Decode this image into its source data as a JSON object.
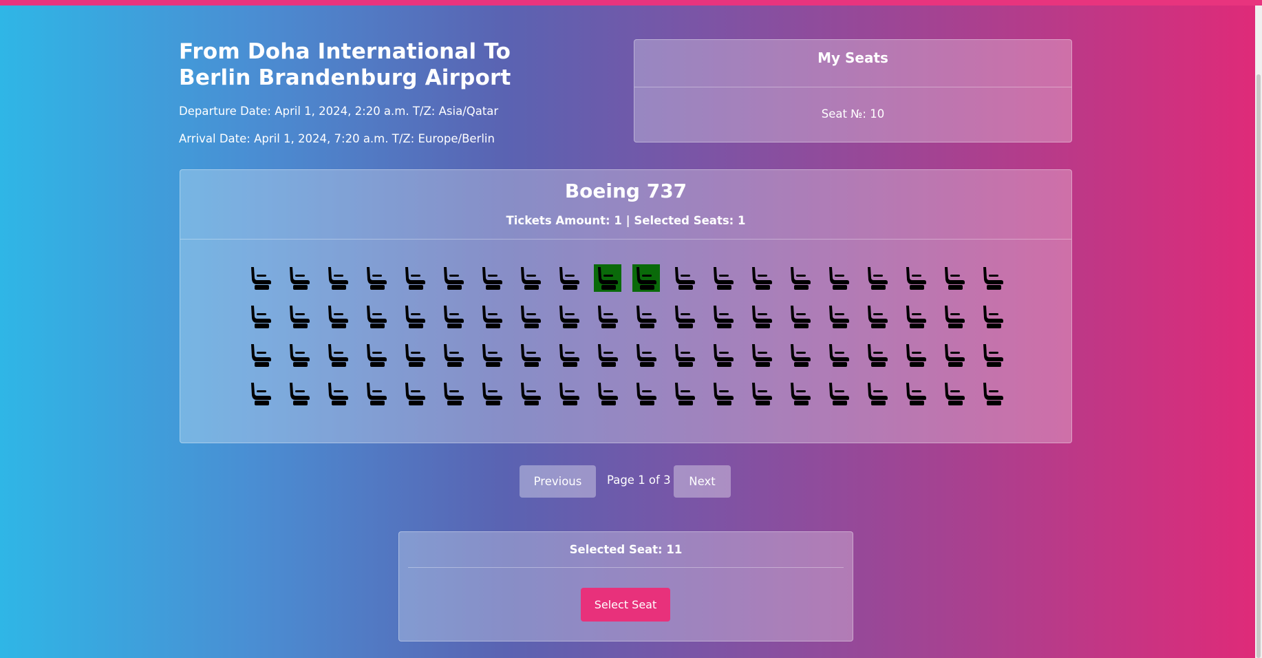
{
  "flight": {
    "title": "From Doha International To Berlin Brandenburg Airport",
    "departure": "Departure Date: April 1, 2024, 2:20 a.m. T/Z: Asia/Qatar",
    "arrival": "Arrival Date: April 1, 2024, 7:20 a.m. T/Z: Europe/Berlin"
  },
  "my_seats": {
    "title": "My Seats",
    "seat": "Seat №: 10"
  },
  "plane": {
    "name": "Boeing 737",
    "tickets": "Tickets Amount: 1 | Selected Seats: 1",
    "rows": 4,
    "columns": 20,
    "highlighted_seats": [
      10,
      11
    ],
    "seat_icon": "airline-seat-icon",
    "highlight_color": "#0a6a0a"
  },
  "pagination": {
    "previous": "Previous",
    "page_info": "Page 1 of 3",
    "next": "Next"
  },
  "selection": {
    "title": "Selected Seat: 11",
    "button": "Select Seat",
    "button_color": "#e8317b"
  }
}
